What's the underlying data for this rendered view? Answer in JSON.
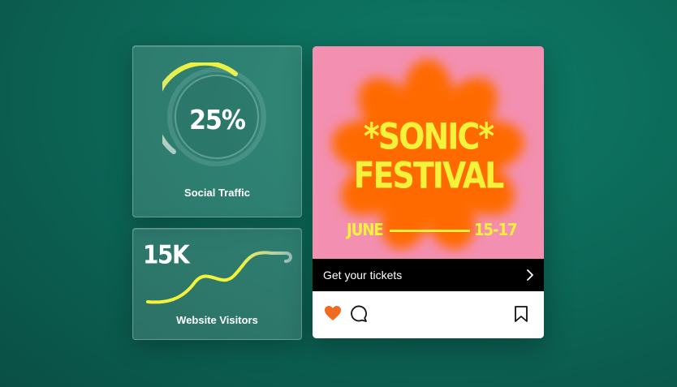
{
  "traffic_card": {
    "value": "25%",
    "progress_fraction": 0.25,
    "label": "Social Traffic"
  },
  "visitors_card": {
    "value": "15K",
    "label": "Website Visitors"
  },
  "post": {
    "title_line1": "*SONIC*",
    "title_line2": "FESTIVAL",
    "date_left": "JUNE",
    "date_right": "15-17",
    "cta_label": "Get your tickets",
    "icons": [
      "heart-icon",
      "comment-icon",
      "bookmark-icon",
      "chevron-right-icon"
    ]
  },
  "colors": {
    "accent_yellow": "#f6f23a",
    "poster_pink": "#f38fb0",
    "flower_orange": "#ff6a00",
    "heart_orange": "#f06a1f"
  }
}
